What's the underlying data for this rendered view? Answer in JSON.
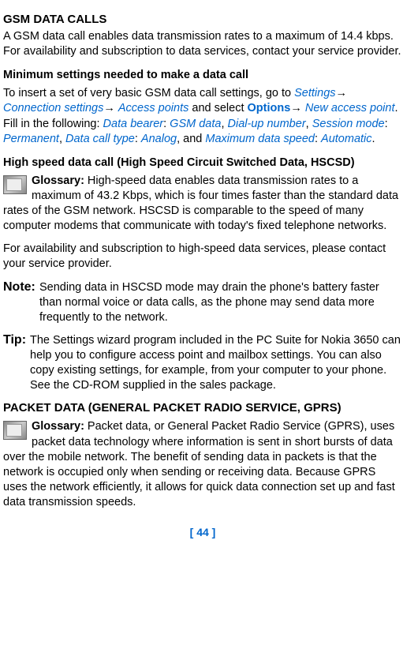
{
  "sections": {
    "gsm": {
      "title": "GSM DATA CALLS",
      "intro": "A GSM data call enables data transmission rates to a maximum of 14.4 kbps. For availability and subscription to data services, contact your service provider."
    },
    "minimum": {
      "heading": "Minimum settings needed to make a data call",
      "body_prefix": "To insert a set of very basic GSM data call settings, go to ",
      "settings": "Settings",
      "arrow1": "→ ",
      "conn_settings": "Connection settings",
      "arrow2": "→ ",
      "access_points": "Access points",
      "and_select": " and select ",
      "options": "Options",
      "arrow3": "→ ",
      "new_ap": "New access point",
      "fill_in": ". Fill in the following: ",
      "data_bearer": "Data bearer",
      "colon1": ": ",
      "gsm_data": "GSM data",
      "comma1": ", ",
      "dial_up": "Dial-up number",
      "comma2": ", ",
      "session_mode": "Session mode",
      "colon2": ": ",
      "permanent": "Permanent",
      "comma3": ", ",
      "data_call_type": "Data call type",
      "colon3": ": ",
      "analog": "Analog",
      "and": ", and ",
      "max_speed": "Maximum data speed",
      "colon4": ": ",
      "automatic": "Automatic",
      "period": "."
    },
    "hscsd": {
      "heading": "High speed data call (High Speed Circuit Switched Data, HSCSD)",
      "glossary_label": "Glossary:",
      "glossary_text": " High-speed data enables data transmission rates to a maximum of 43.2 Kbps, which is four times faster than the standard data rates of the GSM network. HSCSD is comparable to the speed of many computer modems that communicate with today's fixed telephone networks.",
      "availability": "For availability and subscription to high-speed data services, please contact your service provider.",
      "note_label": "Note:",
      "note_text": "Sending data in HSCSD mode may drain the phone's battery faster than normal voice or data calls, as the phone may send data more frequently to the network.",
      "tip_label": "Tip:",
      "tip_text": "The Settings wizard program included in the PC Suite for Nokia 3650 can help you to configure access point and mailbox settings. You can also copy existing settings, for example, from your computer to your phone. See the CD-ROM supplied in the sales package."
    },
    "gprs": {
      "heading": "PACKET DATA (GENERAL PACKET RADIO SERVICE, GPRS)",
      "glossary_label": "Glossary:",
      "glossary_text": " Packet data, or General Packet Radio Service (GPRS), uses packet data technology where information is sent in short bursts of data over the mobile network. The benefit of sending data in packets is that the network is occupied only when sending or receiving data. Because GPRS uses the network efficiently, it allows for quick data connection set up and fast data transmission speeds."
    }
  },
  "page_number": "[ 44 ]"
}
